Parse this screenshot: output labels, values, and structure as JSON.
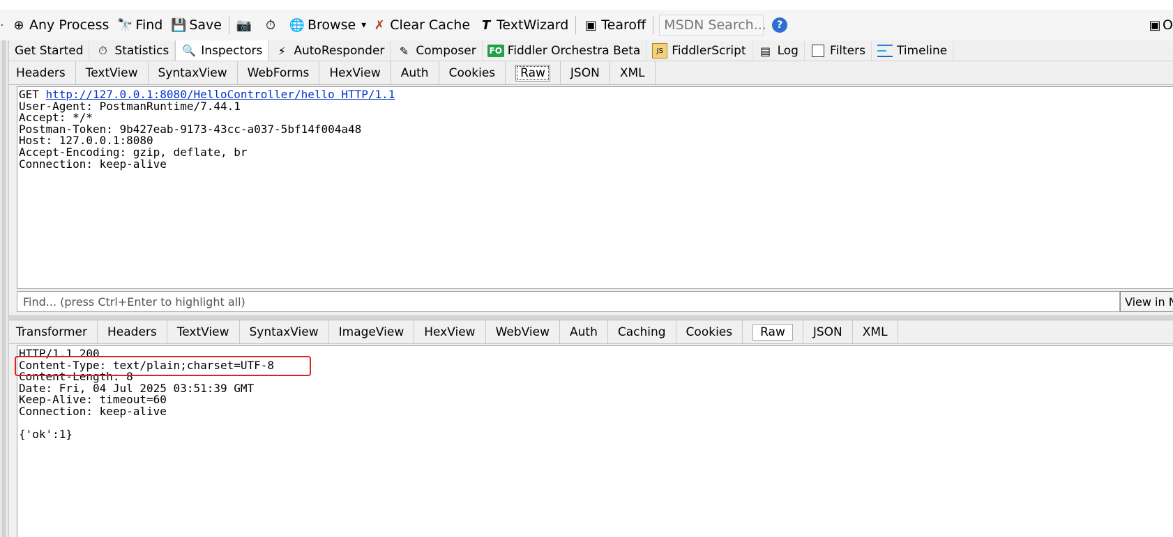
{
  "toolbar": {
    "items": [
      {
        "icon": "target-icon",
        "glyph": "⊕",
        "label": "Any Process"
      },
      {
        "icon": "binoculars-icon",
        "glyph": "🔭",
        "label": "Find"
      },
      {
        "icon": "save-icon",
        "glyph": "💾",
        "label": "Save"
      }
    ],
    "items2": [
      {
        "icon": "camera-icon",
        "glyph": "📷",
        "label": ""
      },
      {
        "icon": "timer-icon",
        "glyph": "⏱",
        "label": ""
      },
      {
        "icon": "browser-icon",
        "glyph": "🌐",
        "label": "Browse"
      }
    ],
    "dropdown_glyph": "▾",
    "clear_cache": {
      "icon": "clear-cache-icon",
      "glyph": "✗",
      "label": "Clear Cache"
    },
    "textwizard": {
      "icon": "textwizard-icon",
      "glyph": "T",
      "label": "TextWizard"
    },
    "tearoff": {
      "icon": "tearoff-icon",
      "glyph": "▣",
      "label": "Tearoff"
    },
    "search_placeholder": "MSDN Search...",
    "help_glyph": "?",
    "right_label": "O"
  },
  "main_tabs": [
    {
      "name": "tab-get-started",
      "label": "Get Started",
      "icon": "",
      "glyph": ""
    },
    {
      "name": "tab-statistics",
      "label": "Statistics",
      "icon": "stopwatch-icon",
      "glyph": "⏱"
    },
    {
      "name": "tab-inspectors",
      "label": "Inspectors",
      "icon": "inspector-icon",
      "glyph": "🔍",
      "active": true
    },
    {
      "name": "tab-autoresponder",
      "label": "AutoResponder",
      "icon": "lightning-icon",
      "glyph": "⚡"
    },
    {
      "name": "tab-composer",
      "label": "Composer",
      "icon": "composer-icon",
      "glyph": "✎"
    },
    {
      "name": "tab-orchestra",
      "label": "Fiddler Orchestra Beta",
      "icon": "fo-icon",
      "glyph": "FO"
    },
    {
      "name": "tab-fiddlerscript",
      "label": "FiddlerScript",
      "icon": "script-icon",
      "glyph": "JS"
    },
    {
      "name": "tab-log",
      "label": "Log",
      "icon": "log-icon",
      "glyph": "▤"
    },
    {
      "name": "tab-filters",
      "label": "Filters",
      "icon": "checkbox-icon",
      "glyph": ""
    },
    {
      "name": "tab-timeline",
      "label": "Timeline",
      "icon": "timeline-icon",
      "glyph": ""
    }
  ],
  "request_tabs": [
    "Headers",
    "TextView",
    "SyntaxView",
    "WebForms",
    "HexView",
    "Auth",
    "Cookies",
    "Raw",
    "JSON",
    "XML"
  ],
  "request_active": "Raw",
  "request": {
    "method": "GET ",
    "url": "http://127.0.0.1:8080/HelloController/hello HTTP/1.1",
    "lines": [
      "User-Agent: PostmanRuntime/7.44.1",
      "Accept: */*",
      "Postman-Token: 9b427eab-9173-43cc-a037-5bf14f004a48",
      "Host: 127.0.0.1:8080",
      "Accept-Encoding: gzip, deflate, br",
      "Connection: keep-alive"
    ]
  },
  "find": {
    "placeholder": "Find... (press Ctrl+Enter to highlight all)",
    "view_button": "View in N"
  },
  "response_tabs": [
    "Transformer",
    "Headers",
    "TextView",
    "SyntaxView",
    "ImageView",
    "HexView",
    "WebView",
    "Auth",
    "Caching",
    "Cookies",
    "Raw",
    "JSON",
    "XML"
  ],
  "response_active": "Raw",
  "response": {
    "lines": [
      "HTTP/1.1 200",
      "Content-Type: text/plain;charset=UTF-8",
      "Content-Length: 8",
      "Date: Fri, 04 Jul 2025 03:51:39 GMT",
      "Keep-Alive: timeout=60",
      "Connection: keep-alive",
      "",
      "{'ok':1}"
    ]
  },
  "colors": {
    "highlight": "#e02020",
    "link": "#0033cc",
    "fo_badge": "#23a14a",
    "help": "#2f6fd1"
  }
}
